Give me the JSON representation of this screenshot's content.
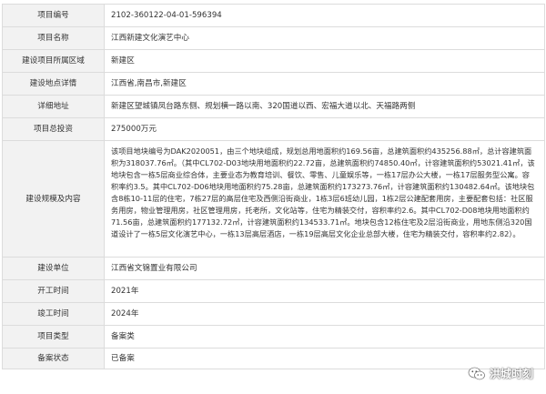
{
  "rows": [
    {
      "label": "项目编号",
      "value": "2102-360122-04-01-596394"
    },
    {
      "label": "项目名称",
      "value": "江西新建文化演艺中心"
    },
    {
      "label": "建设项目所属区域",
      "value": "新建区"
    },
    {
      "label": "建设地点详情",
      "value": "江西省,南昌市,新建区"
    },
    {
      "label": "详细地址",
      "value": "新建区望城镇凤台路东侧、规划横一路以南、320国道以西、宏福大道以北、天福路两侧"
    },
    {
      "label": "项目总投资",
      "value": "275000万元"
    },
    {
      "label": "建设规模及内容",
      "value": "该项目地块编号为DAK2020051，由三个地块组成，规划总用地面积约169.56亩，总建筑面积约435256.88㎡，总计容建筑面积为318037.76㎡。（其中CL702-D03地块用地面积约22.72亩，总建筑面积约74850.40㎡，计容建筑面积约53021.41㎡，该地块包含一栋5层商业综合体，主要业态为教育培训、餐饮、零售、儿童娱乐等，一栋17层办公大楼，一栋17层服务型公寓。容积率约3.5。其中CL702-D06地块用地面积约75.28亩，总建筑面积约173273.76㎡，计容建筑面积约130482.64㎡。该地块包含8栋10-11层的住宅，7栋27层的高层住宅及西侧沿街商业，1栋3层6班幼儿园，1栋2层公建配套用房，主要配套包括：社区服务用房，物业管理用房，社区管理用房，托老所，文化站等，住宅为精装交付，容积率约2.6。其中CL702-D08地块用地面积约71.56亩，总建筑面积约177132.72㎡，计容建筑面积约134533.71㎡。地块包含12栋住宅及2层沿街商业，用地东侧沿320国道设计了一栋5层文化演艺中心，一栋13层高层酒店，一栋19层高层文化企业总部大楼，住宅为精装交付，容积率约2.82）。"
    },
    {
      "label": "建设单位",
      "value": "江西省文锦置业有限公司"
    },
    {
      "label": "开工时间",
      "value": "2021年"
    },
    {
      "label": "竣工时间",
      "value": "2024年"
    },
    {
      "label": "项目类型",
      "value": "备案类"
    },
    {
      "label": "备案状态",
      "value": "已备案"
    }
  ],
  "watermark": {
    "text": "洪城时刻",
    "icon": "wechat-icon"
  }
}
